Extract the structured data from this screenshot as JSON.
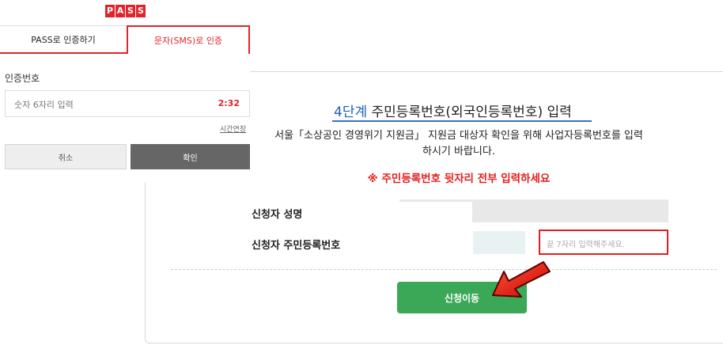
{
  "form": {
    "step_no": "4단계",
    "step_title": " 주민등록번호(외국인등록번호) 입력",
    "desc_line1": "서울「소상공인 경영위기 지원금」 지원금 대상자 확인을 위해 사업자등록번호를 입력",
    "desc_line2": "하시기 바랍니다.",
    "warning": "※ 주민등록번호 뒷자리 전부 입력하세요",
    "name_label": "신청자 성명",
    "rrn_label": "신청자 주민등록번호",
    "rrn_back_placeholder": "끝 7자리 입력해주세요.",
    "submit_label": "신청이동"
  },
  "pass": {
    "logo_letters": [
      "P",
      "A",
      "S",
      "S"
    ],
    "tab_pass": "PASS로 인증하기",
    "tab_sms": "문자(SMS)로 인증",
    "auth_label": "인증번호",
    "auth_placeholder": "숫자 6자리 입력",
    "timer": "2:32",
    "extend": "시간연장",
    "cancel": "취소",
    "confirm": "확인"
  },
  "colors": {
    "accent_red": "#e0242c",
    "submit_green": "#3aa856",
    "step_blue": "#1f5fb8"
  },
  "icons": {
    "pointer_arrow": "red-arrow-icon"
  }
}
